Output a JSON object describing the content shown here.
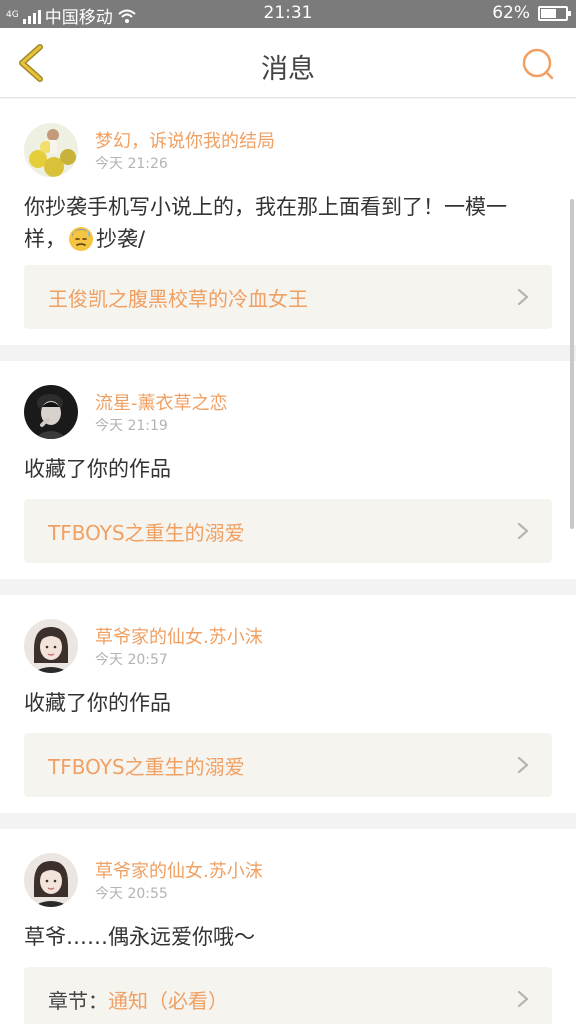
{
  "status_bar": {
    "network": "4G",
    "carrier": "中国移动",
    "time": "21:31",
    "battery": "62%",
    "battery_level": 0.62
  },
  "nav": {
    "title": "消息",
    "back_icon": "chevron-left-icon",
    "search_icon": "search-icon",
    "accent_color": "#f0a062"
  },
  "messages": [
    {
      "avatar": "avatar-flowers",
      "name": "梦幻，诉说你我的结局",
      "time": "今天 21:26",
      "text_before": "你抄袭手机写小说上的，我在那上面看到了！一模一样，",
      "emoji": "sweat-emoji",
      "text_after": "抄袭/",
      "link": {
        "prefix": "",
        "title": "王俊凯之腹黑校草的冷血女王"
      }
    },
    {
      "avatar": "avatar-boy",
      "name": "流星-薰衣草之恋",
      "time": "今天 21:19",
      "text_before": "收藏了你的作品",
      "link": {
        "prefix": "",
        "title": "TFBOYS之重生的溺爱"
      }
    },
    {
      "avatar": "avatar-girl",
      "name": "草爷家的仙女.苏小沫",
      "time": "今天 20:57",
      "text_before": "收藏了你的作品",
      "link": {
        "prefix": "",
        "title": "TFBOYS之重生的溺爱"
      }
    },
    {
      "avatar": "avatar-girl",
      "name": "草爷家的仙女.苏小沫",
      "time": "今天 20:55",
      "text_before": "草爷……偶永远爱你哦～",
      "link": {
        "prefix": "章节：",
        "title": "通知（必看）"
      }
    }
  ]
}
